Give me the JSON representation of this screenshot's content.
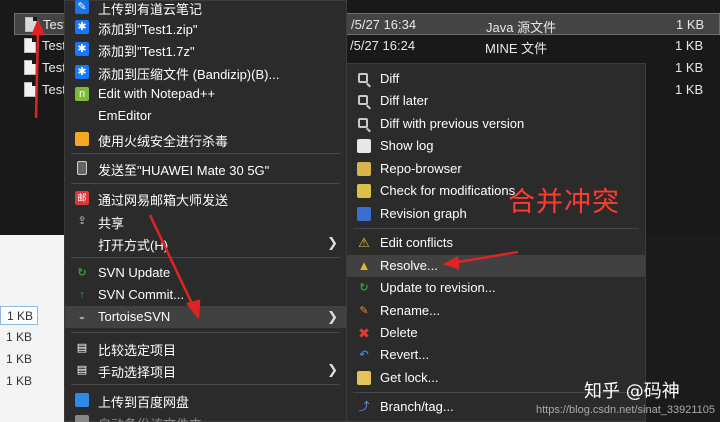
{
  "explorer": {
    "files": [
      {
        "name": "Test",
        "date": "/5/27 16:34",
        "type": "Java 源文件",
        "size": "1 KB",
        "selected": true
      },
      {
        "name": "Test",
        "date": "/5/27 16:24",
        "type": "MINE 文件",
        "size": "1 KB",
        "selected": false
      },
      {
        "name": "Test",
        "date": "",
        "type": "",
        "size": "1 KB",
        "selected": false
      },
      {
        "name": "Test",
        "date": "",
        "type": "",
        "size": "1 KB",
        "selected": false
      }
    ],
    "side_sizes": [
      "1 KB",
      "1 KB",
      "1 KB",
      "1 KB"
    ]
  },
  "context_menu": {
    "items": [
      {
        "label": "上传到有道云笔记",
        "icon": "youdao-note-icon"
      },
      {
        "label": "添加到\"Test1.zip\"",
        "icon": "bandizip-icon"
      },
      {
        "label": "添加到\"Test1.7z\"",
        "icon": "bandizip-icon"
      },
      {
        "label": "添加到压缩文件 (Bandizip)(B)...",
        "icon": "bandizip-icon"
      },
      {
        "label": "Edit with Notepad++",
        "icon": "notepad-plus-plus-icon"
      },
      {
        "label": "EmEditor",
        "icon": ""
      },
      {
        "label": "使用火绒安全进行杀毒",
        "icon": "huorong-shield-icon"
      },
      {
        "label": "发送至\"HUAWEI Mate 30 5G\"",
        "icon": "phone-icon"
      },
      {
        "label": "通过网易邮箱大师发送",
        "icon": "netease-mail-icon"
      },
      {
        "label": "共享",
        "icon": "share-icon"
      },
      {
        "label": "打开方式(H)",
        "icon": ""
      },
      {
        "label": "SVN Update",
        "icon": "svn-update-icon"
      },
      {
        "label": "SVN Commit...",
        "icon": "svn-commit-icon"
      },
      {
        "label": "TortoiseSVN",
        "icon": "tortoise-icon"
      },
      {
        "label": "比较选定项目",
        "icon": "compare-icon"
      },
      {
        "label": "手动选择项目",
        "icon": "manual-select-icon"
      },
      {
        "label": "上传到百度网盘",
        "icon": "baidu-cloud-icon"
      },
      {
        "label": "自动备份该文件夹",
        "icon": "backup-icon"
      }
    ]
  },
  "submenu": {
    "items": [
      {
        "label": "Diff",
        "icon": "diff-icon"
      },
      {
        "label": "Diff later",
        "icon": "diff-later-icon"
      },
      {
        "label": "Diff with previous version",
        "icon": "diff-previous-icon"
      },
      {
        "label": "Show log",
        "icon": "show-log-icon"
      },
      {
        "label": "Repo-browser",
        "icon": "repo-browser-icon"
      },
      {
        "label": "Check for modifications",
        "icon": "check-modifications-icon"
      },
      {
        "label": "Revision graph",
        "icon": "revision-graph-icon"
      },
      {
        "label": "Edit conflicts",
        "icon": "edit-conflicts-icon"
      },
      {
        "label": "Resolve...",
        "icon": "resolve-icon"
      },
      {
        "label": "Update to revision...",
        "icon": "update-revision-icon"
      },
      {
        "label": "Rename...",
        "icon": "rename-icon"
      },
      {
        "label": "Delete",
        "icon": "delete-icon"
      },
      {
        "label": "Revert...",
        "icon": "revert-icon"
      },
      {
        "label": "Get lock...",
        "icon": "lock-icon"
      },
      {
        "label": "Branch/tag...",
        "icon": "branch-tag-icon"
      }
    ]
  },
  "annotation": {
    "text": "合并冲突",
    "color": "#ff3b30"
  },
  "watermark": {
    "text": "知乎 @码神",
    "url": "https://blog.csdn.net/sinat_33921105"
  }
}
